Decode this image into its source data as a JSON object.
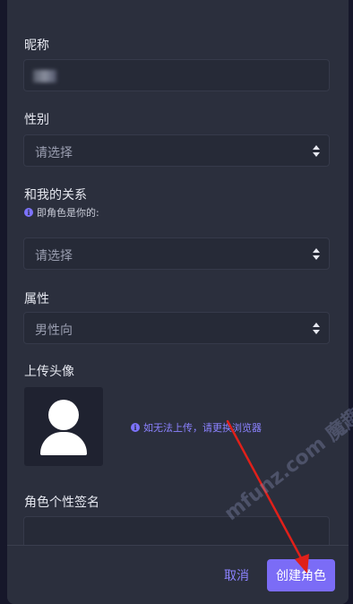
{
  "form": {
    "nickname": {
      "label": "昵称"
    },
    "gender": {
      "label": "性别",
      "value": "请选择"
    },
    "relation": {
      "label": "和我的关系",
      "hint": "即角色是你的:",
      "value": "请选择"
    },
    "attribute": {
      "label": "属性",
      "value": "男性向"
    },
    "avatar": {
      "label": "上传头像",
      "hint": "如无法上传，请更换浏览器"
    },
    "signature": {
      "label": "角色个性签名"
    }
  },
  "footer": {
    "cancel_label": "取消",
    "create_label": "创建角色"
  },
  "icons": {
    "info": "i",
    "select": "sort-arrows-icon",
    "avatar": "user-silhouette-icon"
  },
  "colors": {
    "accent": "#7b6cf6",
    "link": "#8b82ff",
    "panel": "#2b2f3d",
    "field": "#262a37",
    "annotation_arrow": "#e0201a"
  },
  "watermark": {
    "text": "mfunz.com 魔趣网"
  }
}
